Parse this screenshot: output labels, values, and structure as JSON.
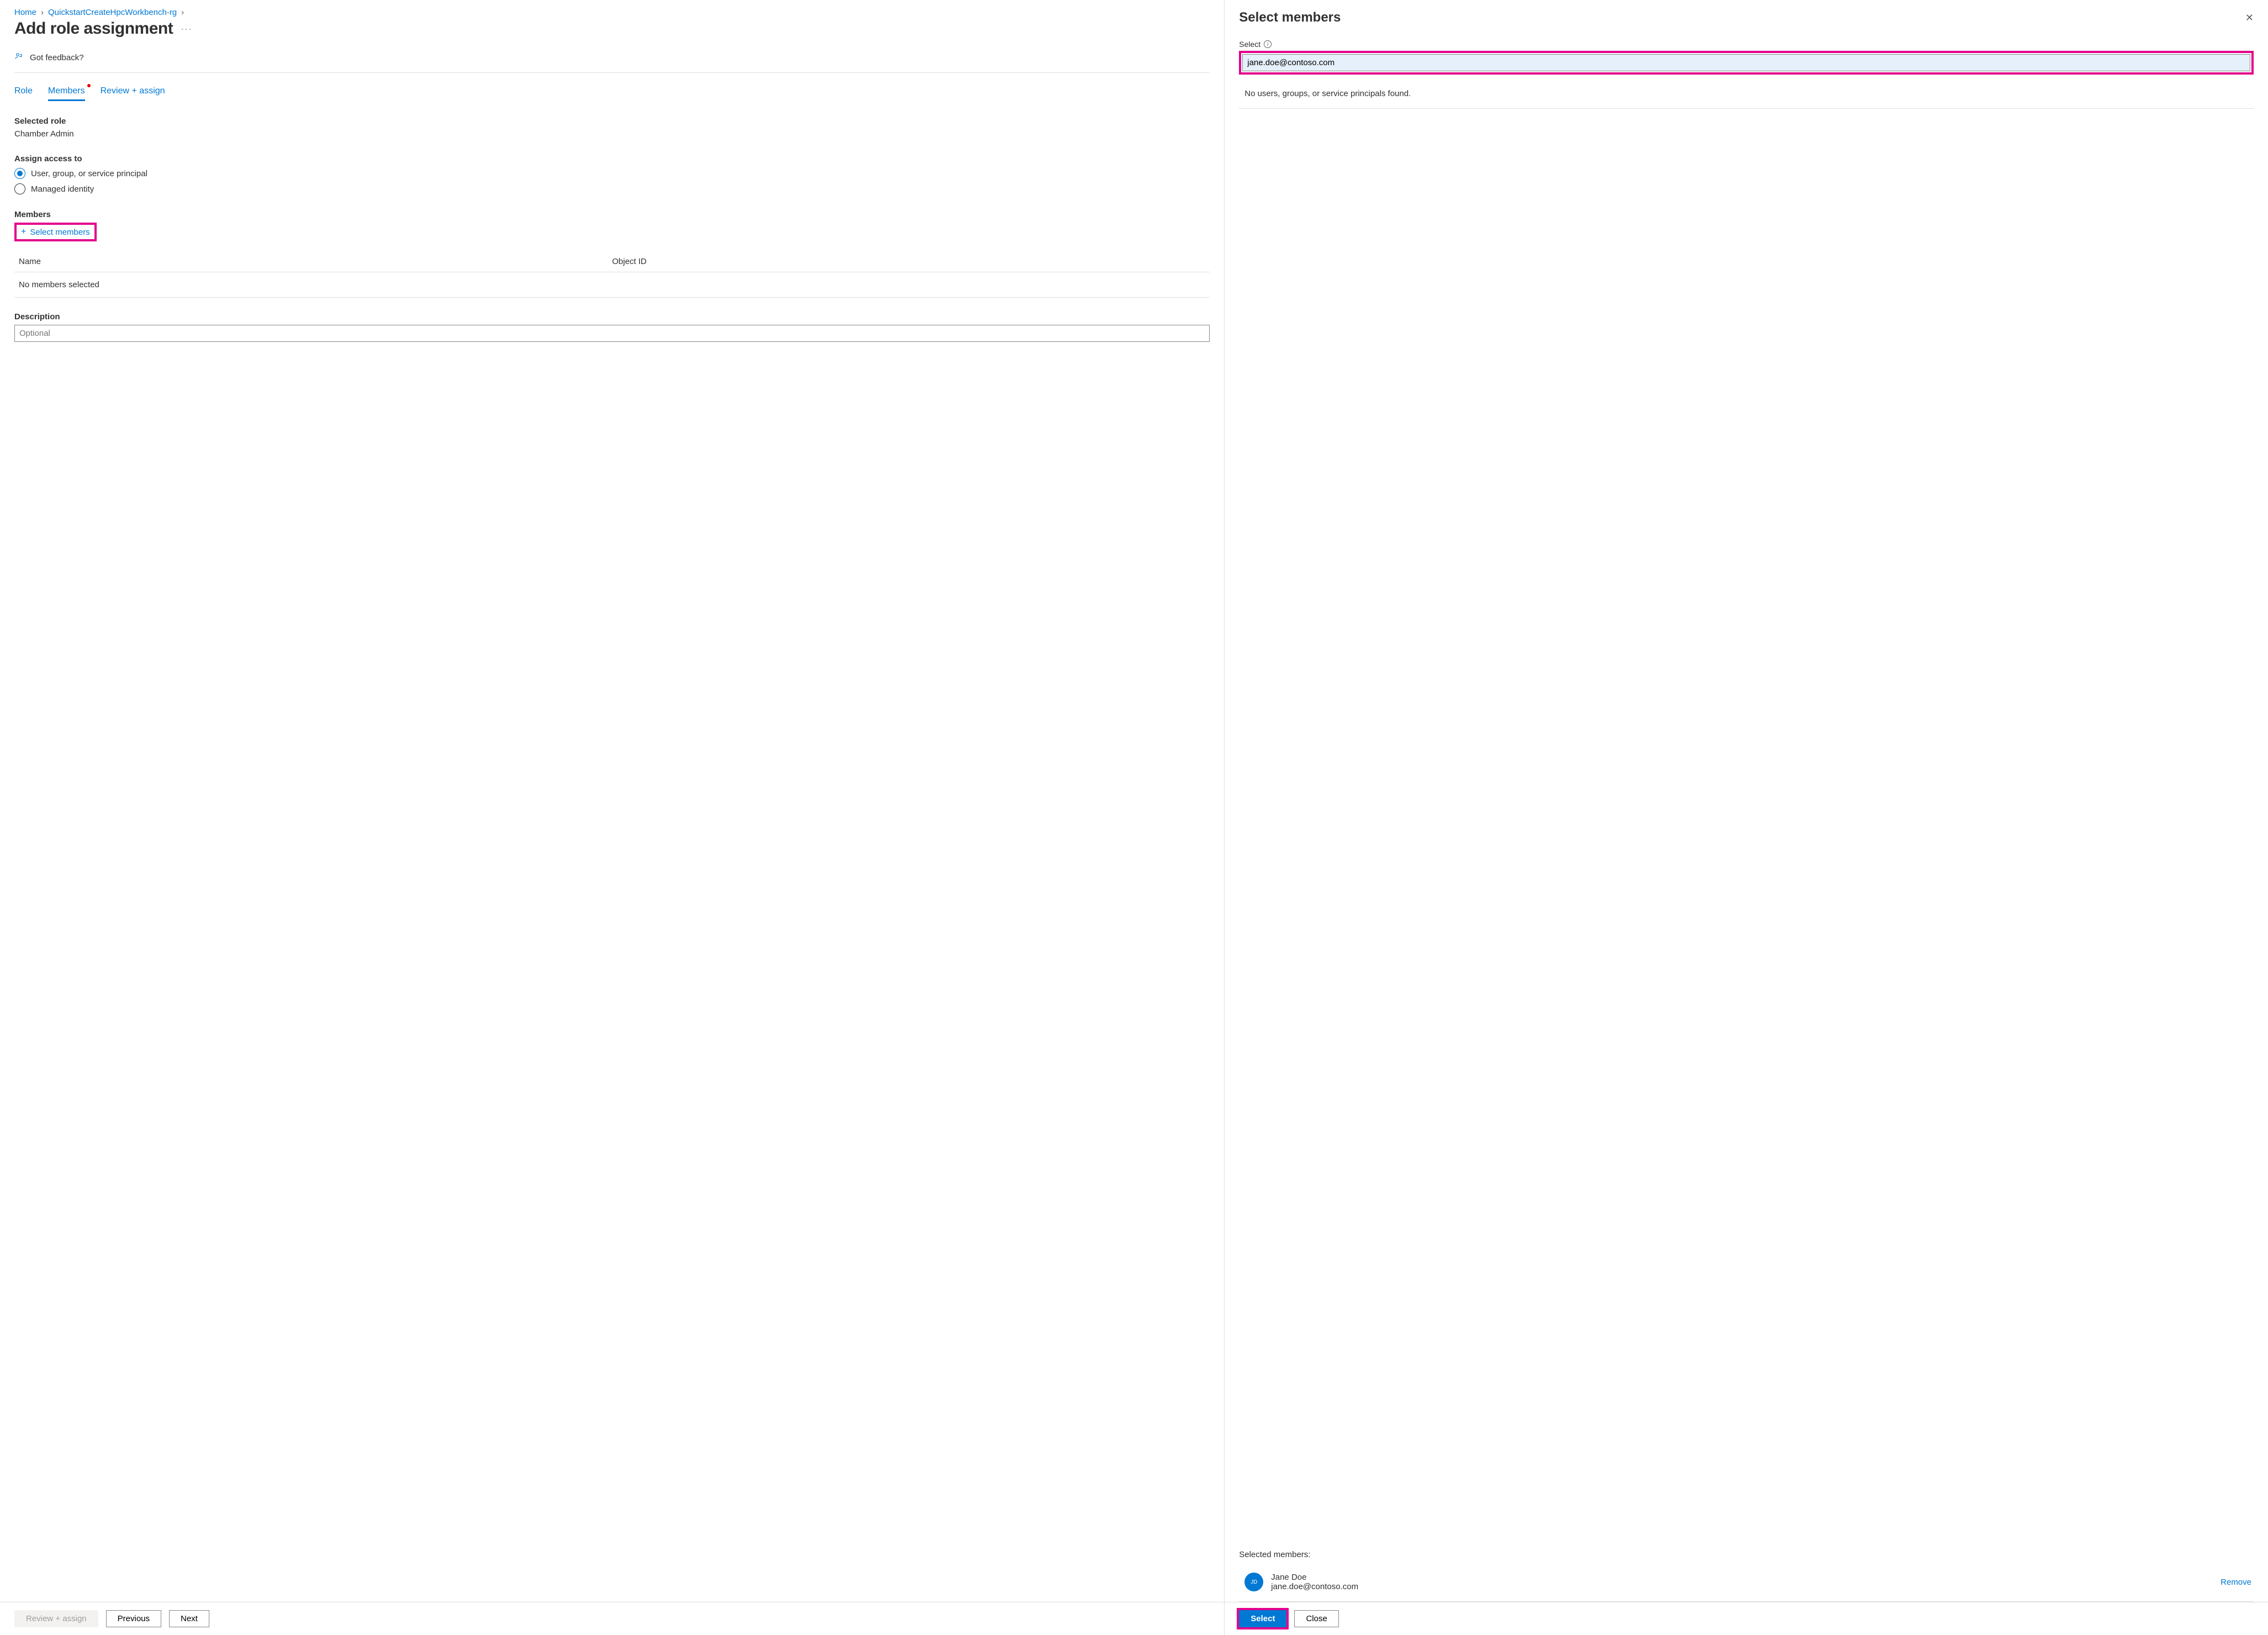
{
  "breadcrumb": {
    "home": "Home",
    "rg": "QuickstartCreateHpcWorkbench-rg"
  },
  "page_title": "Add role assignment",
  "feedback": "Got feedback?",
  "tabs": {
    "role": "Role",
    "members": "Members",
    "review": "Review + assign"
  },
  "selected_role_label": "Selected role",
  "selected_role_value": "Chamber Admin",
  "assign_access_label": "Assign access to",
  "assign_options": {
    "user_group": "User, group, or service principal",
    "managed_identity": "Managed identity"
  },
  "members_label": "Members",
  "select_members_link": "Select members",
  "members_table": {
    "col_name": "Name",
    "col_obj": "Object ID",
    "empty": "No members selected"
  },
  "description_label": "Description",
  "description_placeholder": "Optional",
  "footer_buttons": {
    "review": "Review + assign",
    "previous": "Previous",
    "next": "Next"
  },
  "panel": {
    "title": "Select members",
    "select_label": "Select",
    "search_value": "jane.doe@contoso.com",
    "no_results": "No users, groups, or service principals found.",
    "selected_label": "Selected members:",
    "member": {
      "initials": "JD",
      "name": "Jane Doe",
      "email": "jane.doe@contoso.com"
    },
    "remove": "Remove",
    "select_btn": "Select",
    "close_btn": "Close"
  }
}
